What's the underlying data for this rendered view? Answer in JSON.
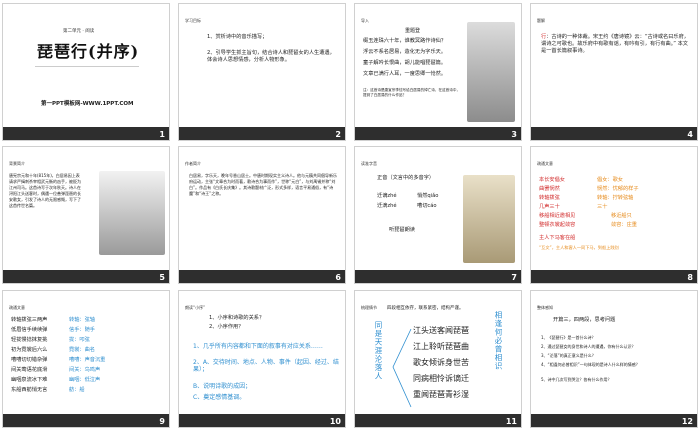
{
  "slides": [
    {
      "num": "1",
      "subtitle": "第二单元 · 阅读",
      "title": "琵琶行(并序)",
      "footer_text": "第一PPT模板网-WWW.1PPT.COM"
    },
    {
      "num": "2",
      "heading": "学习目标",
      "points": [
        "1、赏析诗中的音乐描写；",
        "2、引导学生抓主旨句，结合诗人和琵琶女的人生遭遇，体会诗人思想情感，分析人物形象。"
      ]
    },
    {
      "num": "3",
      "heading": "导入",
      "poem_title": "重题登",
      "lines": [
        "缀玉连珠六十年，谁教冥路作诗仙？",
        "浮云不系名居易，造化无为字乐天。",
        "童子解吟长恨曲，胡儿能唱琵琶篇。",
        "文章已满行人耳，一度思卿一怆然。"
      ],
      "note": "注：这首诗是唐宣宗李忱写给白居易的悼亡诗，在这首诗中，提到了白居易的什么作品？"
    },
    {
      "num": "4",
      "heading": "题解",
      "text_prefix": "行",
      "text": "：古诗的一种体裁。宋王约《唐诗镜》云：“古诗或名曰乐府，谓诗之可歌也。故乐府中有歌有谣，有吟有引，有行有曲。” 本文是一首长篇叙事诗。"
    },
    {
      "num": "5",
      "heading": "背景简介",
      "body": "唐宪宗元和十年(815年)，白居易因上表请求严缉刺杀宰相武元衡的凶手，被贬为江州司马。这首诗写于次年秋天。诗人在浔阳江头送客时，偶遇一位善弹琵琶的长安歌女，引发了诗人的无限感慨，写下了这首传世名篇。"
    },
    {
      "num": "6",
      "heading": "作者简介",
      "body": "白居易，字乐天，晚年号香山居士。中唐时期现实主义诗人。他与元稹共同倡导新乐府运动，主张“文章合为时而著，歌诗合为事而作”，世称“元白”，与刘禹锡并称“刘白”。作品有《白氏长庆集》。其诗歌题材广泛，形式多样，语言平易通俗，有“诗魔”和“诗王”之称。"
    },
    {
      "num": "7",
      "heading": "读准字音",
      "label": "正音（文言中的多音字）",
      "words": [
        [
          "迁谪zhé",
          "悄然qiǎo"
        ],
        [
          "迁滴zhé",
          "嘈切cáo"
        ]
      ],
      "extra": "听琵琶朗读"
    },
    {
      "num": "8",
      "heading": "疏通文意",
      "lines": [
        [
          "本长安倡女",
          "倡女：歌女"
        ],
        [
          "曲罢悯然",
          "悯然：忧郁的样子"
        ],
        [
          "转轴拨弦",
          "转轴：拧转弦轴"
        ],
        [
          "几声三十",
          "三十"
        ],
        [
          "移船相近邀相见",
          "移近船只"
        ],
        [
          "整顿衣裳起敛容",
          "敛容：庄重"
        ],
        [
          "主人下马客在船",
          "“互文”，主人和客人一同下马，到船上践别"
        ]
      ]
    },
    {
      "num": "9",
      "heading": "疏通文意",
      "lines": [
        [
          "转轴拨弦三两声",
          "转轴：弦轴"
        ],
        [
          "低眉信手续续弹",
          "信手：随手"
        ],
        [
          "轻拢慢捻抹复挑",
          "拢：叩弦"
        ],
        [
          "初为霓裳后六么",
          "霓裳：曲名"
        ],
        [
          "嘈嘈切切错杂弹",
          "嘈嘈：声音沉重"
        ],
        [
          "间关莺语花底滑",
          "间关：鸟鸣声"
        ],
        [
          "幽咽泉流冰下难",
          "幽咽：低泣声"
        ],
        [
          "东船西舫悄无言",
          "舫：船"
        ]
      ]
    },
    {
      "num": "10",
      "heading": "朗读“小序”",
      "questions": [
        "1、小序和诗歌的关系？",
        "2、小序作用？"
      ],
      "answers": [
        "1、几乎所有内容都和下面的叙事有对应关系……",
        "2、A、交待时间、地点、人物、事件（起因、经过、结果）；",
        "B、说明诗歌的成因；",
        "C、奠定感情基调。"
      ]
    },
    {
      "num": "11",
      "heading": "梳理情节",
      "intro": "四段相互依存，联系紧密，结构严谨。",
      "left_vert": "同是天涯沦落人",
      "right_vert": "相逢何必曾相识",
      "items": [
        "江头送客闻琵琶",
        "江上聆听琵琶曲",
        "歌女倾诉身世苦",
        "同病相怜诉谪迁",
        "重闻琵琶青衫湿"
      ]
    },
    {
      "num": "12",
      "heading": "整体感知",
      "subhead": "开篇三，四两段，思考问题",
      "questions": [
        "1、《琵琶行》是一首什么诗？",
        "2、通过琵琶女的身世和诗人的遭遇，你有什么认识？",
        "3、“沦落”的真正意义是什么？",
        "4、“相逢何必曾相识”一句体现的是诗人什么样的情感？",
        "5、诗中几次写到哭泣？各有什么作用？"
      ]
    }
  ]
}
